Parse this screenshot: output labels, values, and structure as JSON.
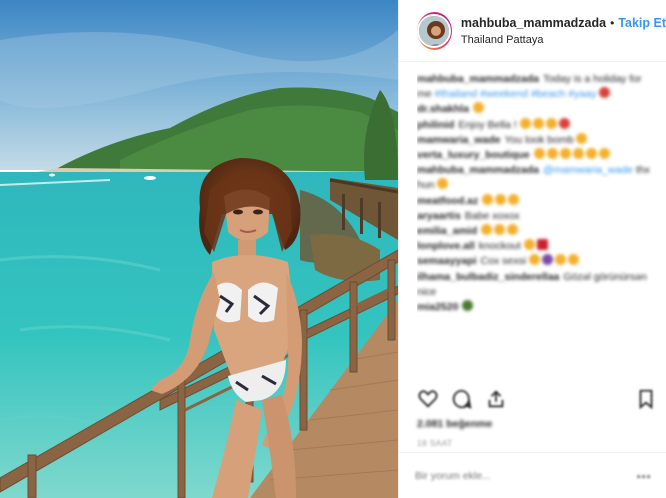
{
  "header": {
    "username": "mahbuba_mammadzada",
    "separator": "•",
    "follow_label": "Takip Et",
    "location": "Thailand Pattaya"
  },
  "comments": [
    {
      "user": "mahbuba_mammadzada",
      "text": "Today is a holiday for me",
      "tags": "#thailand #weekend #beach #yaay",
      "emojis": [
        "red"
      ]
    },
    {
      "user": "dr.shakhla",
      "text": "",
      "emojis": [
        "yellow"
      ]
    },
    {
      "user": "philinid",
      "text": "Enjoy Bella !",
      "emojis": [
        "yellow",
        "yellow",
        "yellow",
        "red"
      ]
    },
    {
      "user": "mamwaria_wade",
      "text": "You look bomb",
      "emojis": [
        "yellow"
      ]
    },
    {
      "user": "verta_luxury_boutique",
      "text": "",
      "emojis": [
        "yellow",
        "yellow",
        "yellow",
        "yellow",
        "yellow",
        "yellow"
      ]
    },
    {
      "user": "mahbuba_mammadzada",
      "text": "",
      "mention": "@mamwaria_wade",
      "after": "thx hun",
      "emojis": [
        "yellow"
      ]
    },
    {
      "user": "meatfood.az",
      "text": "",
      "emojis": [
        "yellow",
        "yellow",
        "yellow"
      ]
    },
    {
      "user": "aryaartis",
      "text": "Babe xoxox",
      "emojis": []
    },
    {
      "user": "emilia_amid",
      "text": "",
      "emojis": [
        "yellow",
        "yellow",
        "yellow"
      ]
    },
    {
      "user": "lonplove.all",
      "text": "knockout",
      "emojis": [
        "yellow",
        "flag"
      ]
    },
    {
      "user": "semaayyapi",
      "text": "Cox sexsi",
      "emojis": [
        "yellow",
        "purple",
        "yellow",
        "yellow"
      ]
    },
    {
      "user": "ilhama_bulbadiz_sinderellaa",
      "text": "Gözəl görünürsən nice",
      "emojis": []
    },
    {
      "user": "mia2520",
      "text": "",
      "emojis": [
        "plant"
      ]
    }
  ],
  "likes": "2.081 beğenme",
  "time": "18 SAAT",
  "add_comment_placeholder": "Bir yorum ekle...",
  "more_label": "•••",
  "icons": {
    "like": "heart-icon",
    "comment": "comment-icon",
    "share": "share-icon",
    "save": "bookmark-icon"
  }
}
